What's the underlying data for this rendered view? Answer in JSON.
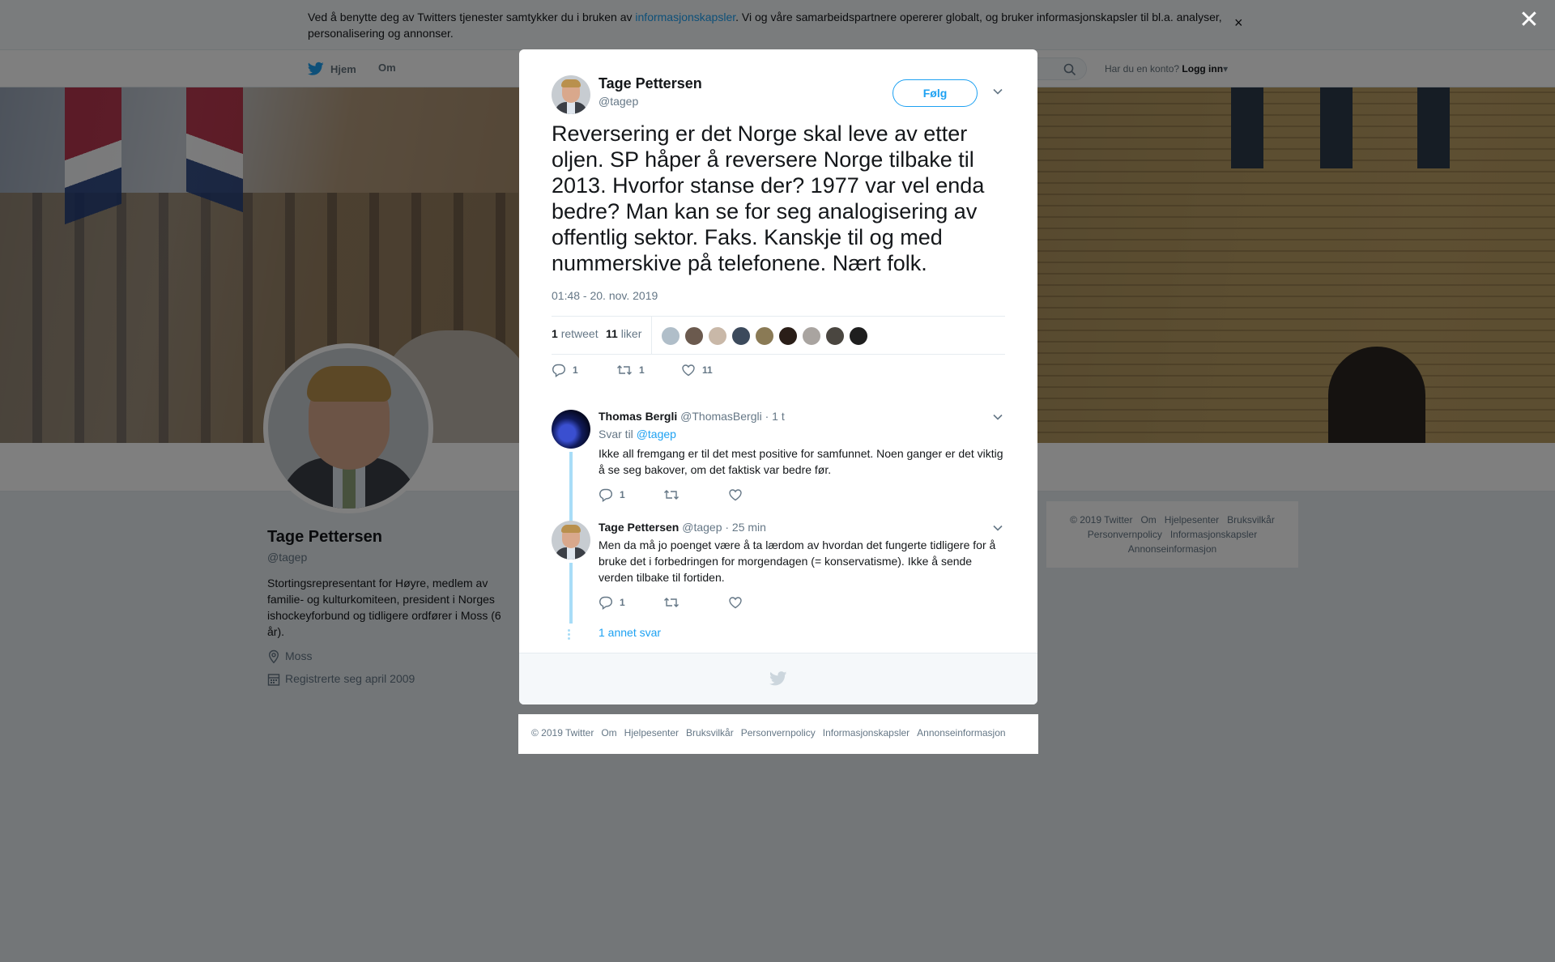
{
  "cookie_banner": {
    "text_before": "Ved å benytte deg av Twitters tjenester samtykker du i bruken av ",
    "link": "informasjonskapsler",
    "text_after": ". Vi og våre samarbeidspartnere opererer globalt, og bruker informasjonskapsler til bl.a. analyser, personalisering og annonser.",
    "close": "×"
  },
  "nav": {
    "home": "Hjem",
    "about": "Om",
    "login_prompt": "Har du en konto?",
    "login": "Logg inn"
  },
  "profile": {
    "name": "Tage Pettersen",
    "handle": "@tagep",
    "bio": "Stortingsrepresentant for Høyre, medlem av familie- og kulturkomiteen, president i Norges ishockeyforbund og tidligere ordfører i Moss (6 år).",
    "location": "Moss",
    "joined": "Registrerte seg april 2009"
  },
  "side_footer": {
    "row1": [
      "© 2019 Twitter",
      "Om",
      "Hjelpesenter",
      "Bruksvilkår"
    ],
    "row2": [
      "Personvernpolicy",
      "Informasjonskapsler"
    ],
    "row3": [
      "Annonseinformasjon"
    ]
  },
  "overlay": {
    "close": "✕"
  },
  "tweet": {
    "author_name": "Tage Pettersen",
    "author_handle": "@tagep",
    "follow": "Følg",
    "text": "Reversering er det Norge skal leve av etter oljen. SP håper å reversere Norge tilbake til 2013. Hvorfor stanse der? 1977 var vel enda bedre? Man kan se for seg analogisering av offentlig sektor. Faks. Kanskje til og med nummerskive på telefonene. Nært folk.",
    "time": "01:48 - 20. nov. 2019",
    "retweets_count": "1",
    "retweets_label": "retweet",
    "likes_count": "11",
    "likes_label": "liker",
    "action_reply": "1",
    "action_retweet": "1",
    "action_like": "11",
    "liker_colors": [
      "#b0bec9",
      "#6b5a4e",
      "#c9b8a8",
      "#3c4a5c",
      "#8a7a55",
      "#2a1e18",
      "#a9a4a0",
      "#4a4640",
      "#1f1f1f"
    ]
  },
  "replies": [
    {
      "name": "Thomas Bergli",
      "handle": "@ThomasBergli",
      "time": "· 1 t",
      "reply_to_prefix": "Svar til ",
      "reply_to_handle": "@tagep",
      "text": "Ikke all fremgang er til det mest positive for samfunnet. Noen ganger er det viktig å se seg bakover, om det faktisk var bedre før.",
      "reply_count": "1"
    },
    {
      "name": "Tage Pettersen",
      "handle": "@tagep",
      "time": "· 25 min",
      "text": "Men da må jo poenget være å ta lærdom av hvordan det fungerte tidligere for å bruke det i forbedringen for morgendagen (= konservatisme). Ikke å sende verden tilbake til fortiden.",
      "reply_count": "1"
    }
  ],
  "more_replies": "1 annet svar",
  "bottom_footer": [
    "© 2019 Twitter",
    "Om",
    "Hjelpesenter",
    "Bruksvilkår",
    "Personvernpolicy",
    "Informasjonskapsler",
    "Annonseinformasjon"
  ],
  "colors": {
    "accent": "#1da1f2",
    "thread": "#a8ddf7",
    "muted": "#657786"
  }
}
